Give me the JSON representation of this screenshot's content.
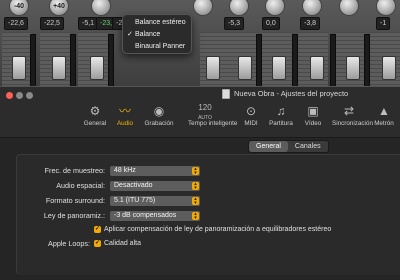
{
  "mixer": {
    "knobs": [
      "-40",
      "+40",
      "",
      "",
      "",
      "",
      "",
      "",
      ""
    ],
    "values": [
      "-22,6",
      "-22,5",
      "-5,1",
      "-23,0",
      "-2,8",
      "",
      "-5,3",
      "0,0",
      "-3,8",
      "-1"
    ],
    "green_value_color": "#6ed36e"
  },
  "pan_menu": {
    "items": [
      {
        "label": "Balance estéreo",
        "checked": false
      },
      {
        "label": "Balance",
        "checked": true
      },
      {
        "label": "Binaural Panner",
        "checked": false
      }
    ],
    "check_glyph": "✓"
  },
  "window": {
    "title": "Nueva Obra - Ajustes del proyecto",
    "traffic_lights": [
      "#ff5f57",
      "#8a8a8a",
      "#8a8a8a"
    ],
    "toolbar": [
      {
        "label": "General",
        "icon": "gear-icon",
        "glyph": "⚙",
        "active": false
      },
      {
        "label": "Audio",
        "icon": "waveform-icon",
        "glyph": "〰",
        "active": true
      },
      {
        "label": "Grabación",
        "icon": "record-icon",
        "glyph": "◉",
        "active": false
      },
      {
        "label": "Tempo inteligente",
        "icon": "tempo-icon",
        "glyph": "120",
        "sub": "AUTO",
        "active": false
      },
      {
        "label": "MIDI",
        "icon": "midi-icon",
        "glyph": "⊙",
        "active": false
      },
      {
        "label": "Partitura",
        "icon": "score-icon",
        "glyph": "♫",
        "active": false
      },
      {
        "label": "Vídeo",
        "icon": "video-icon",
        "glyph": "▣",
        "active": false
      },
      {
        "label": "Sincronización",
        "icon": "sync-icon",
        "glyph": "⇄",
        "active": false
      },
      {
        "label": "Metrón",
        "icon": "metronome-icon",
        "glyph": "▲",
        "active": false
      }
    ],
    "accent": "#f2b400"
  },
  "tabs": {
    "general": "General",
    "channels": "Canales",
    "selected": "General"
  },
  "settings": {
    "sample_rate": {
      "label": "Frec. de muestreo:",
      "value": "48 kHz"
    },
    "spatial_audio": {
      "label": "Audio espacial:",
      "value": "Desactivado"
    },
    "surround": {
      "label": "Formato surround:",
      "value": "5.1 (ITU 775)"
    },
    "pan_law": {
      "label": "Ley de panoramiz.:",
      "value": "-3 dB compensados"
    },
    "pan_comp": {
      "label": "Aplicar compensación de ley de panoramización a equilibradores estéreo",
      "checked": true
    },
    "apple_loops": {
      "label": "Apple Loops:",
      "option": "Calidad alta",
      "checked": true
    }
  }
}
